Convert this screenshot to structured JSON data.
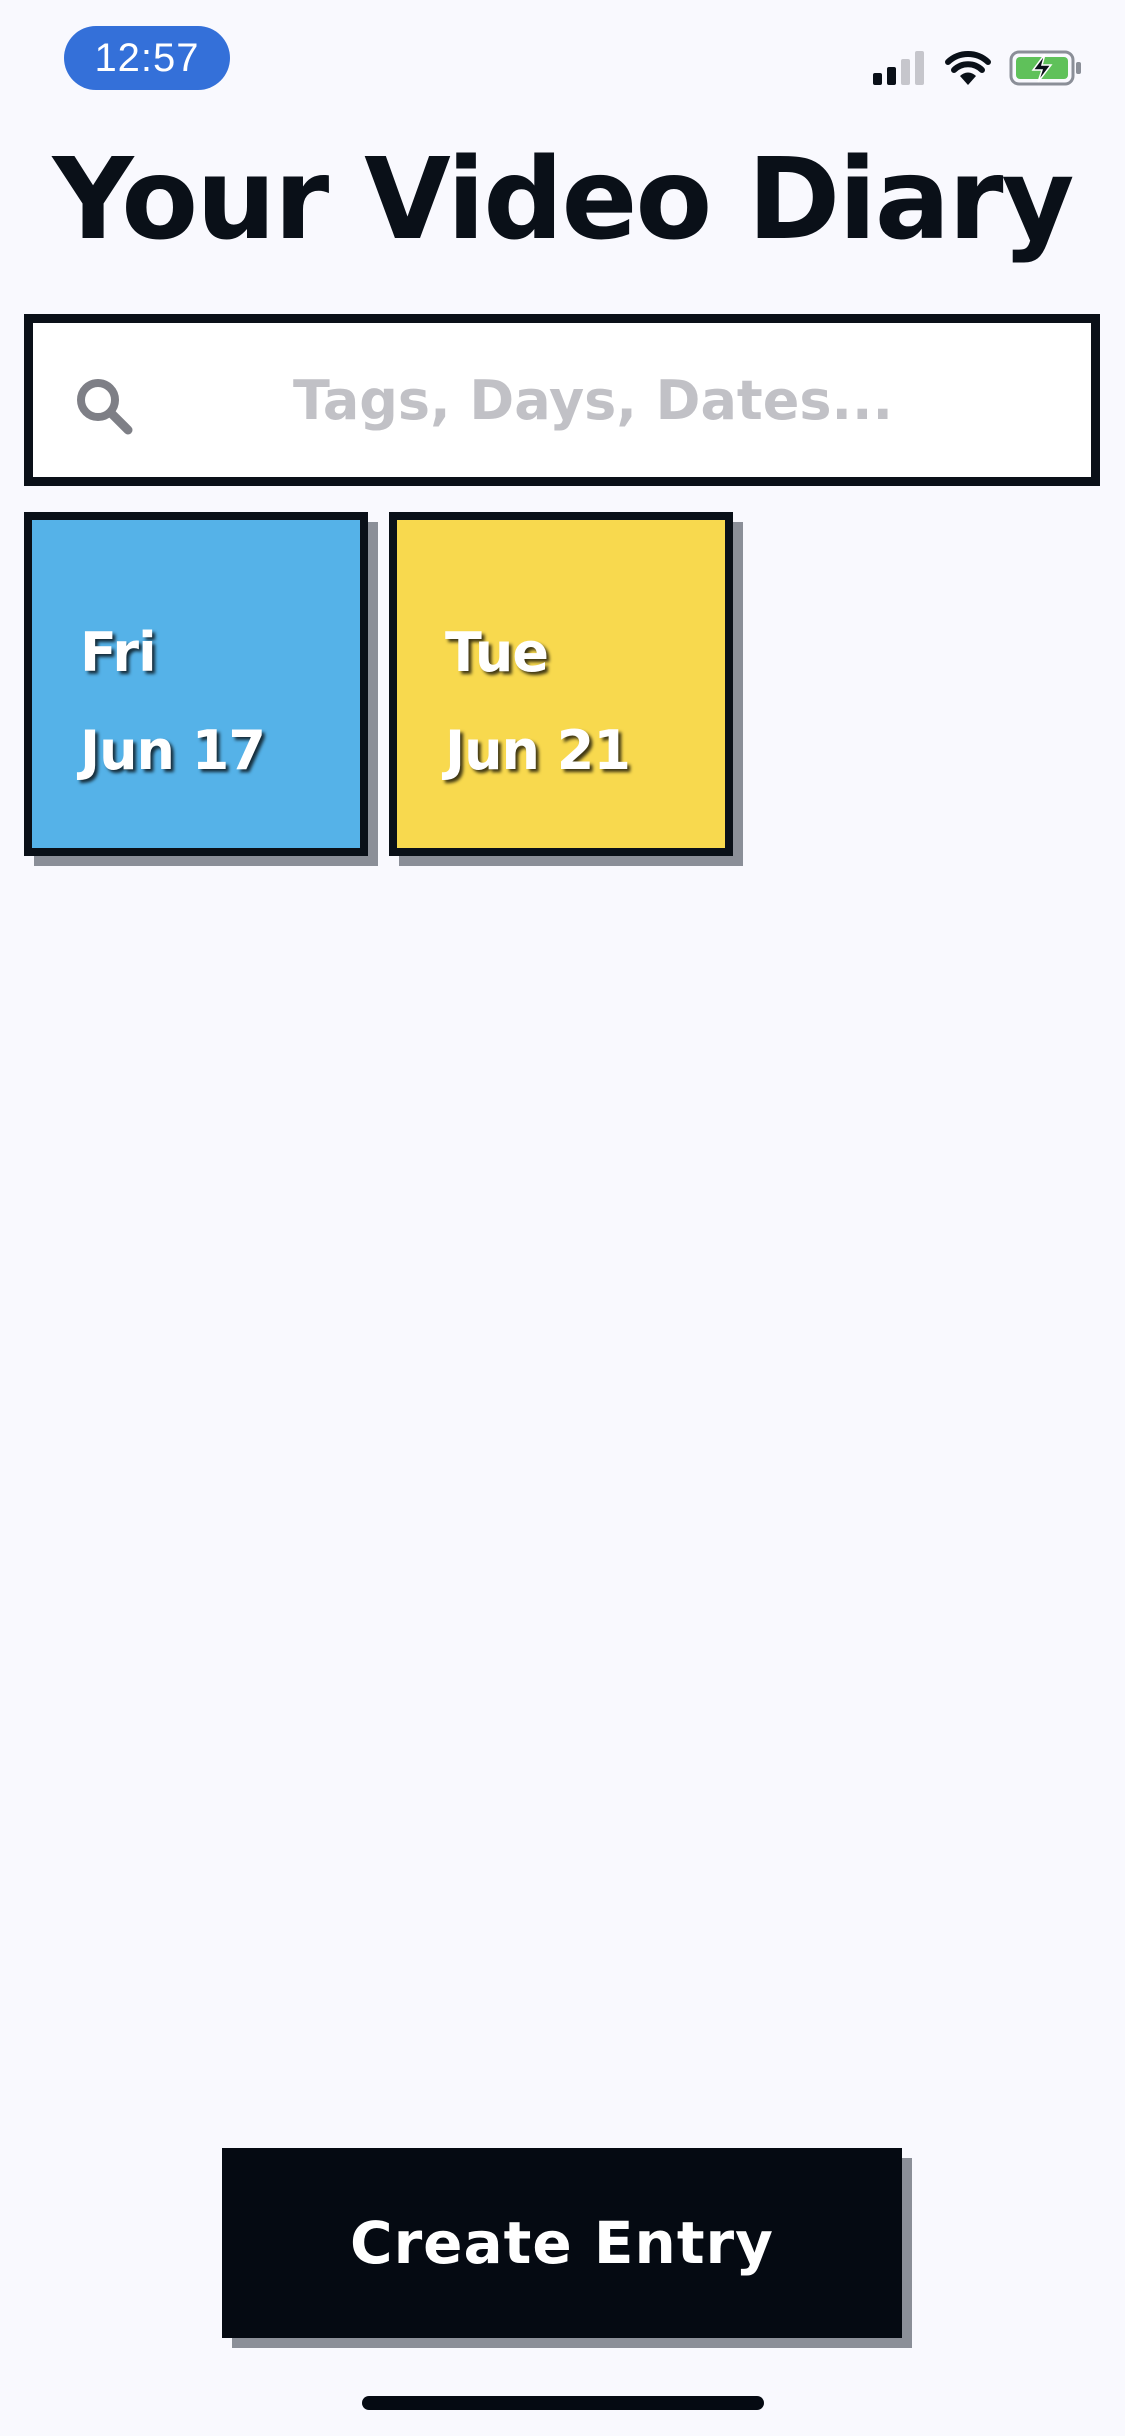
{
  "status_bar": {
    "time": "12:57",
    "icons": [
      "cellular-signal-icon",
      "wifi-icon",
      "battery-charging-icon"
    ],
    "pill_color": "#3470d9",
    "battery_color": "#5fc15a"
  },
  "header": {
    "title": "Your Video Diary"
  },
  "search": {
    "placeholder": "Tags, Days, Dates...",
    "value": "",
    "icon": "search-icon"
  },
  "entries": [
    {
      "day": "Fri",
      "date": "Jun 17",
      "color": "#55b2e8"
    },
    {
      "day": "Tue",
      "date": "Jun 21",
      "color": "#f8d94e"
    }
  ],
  "actions": {
    "create_label": "Create Entry"
  },
  "colors": {
    "background": "#f9f9fe",
    "ink": "#0a1018",
    "shadow": "#8b8f98"
  }
}
